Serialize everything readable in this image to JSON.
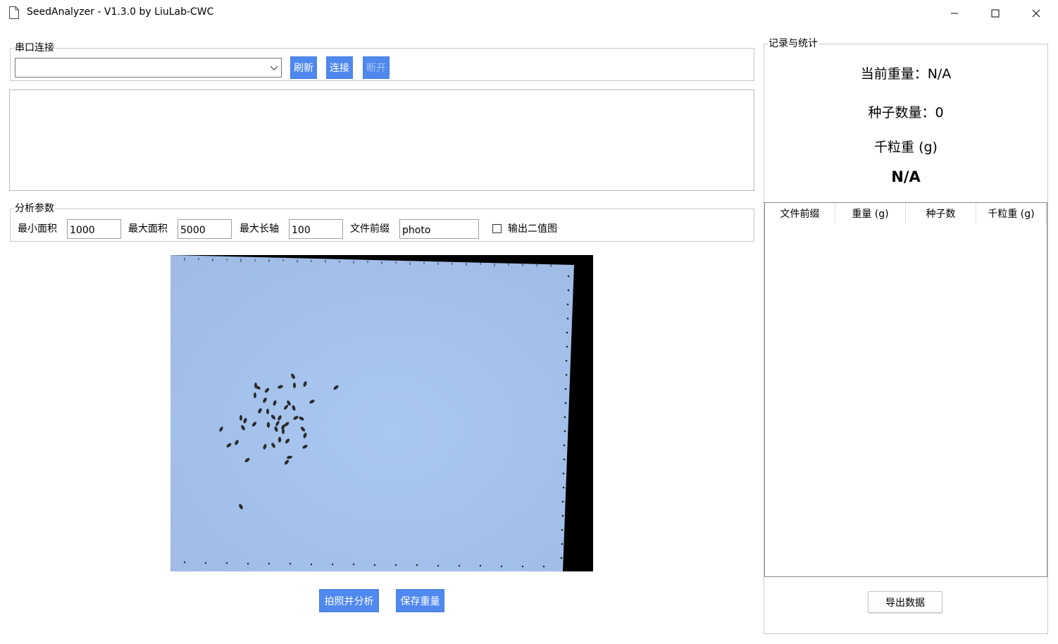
{
  "window": {
    "title": "SeedAnalyzer - V1.3.0 by LiuLab-CWC",
    "icon": "document-icon",
    "controls": [
      "minimize-icon",
      "maximize-icon",
      "close-icon"
    ]
  },
  "serial": {
    "group_label": "串口连接",
    "port_value": "",
    "refresh_label": "刷新",
    "connect_label": "连接",
    "disconnect_label": "断开",
    "log_text": ""
  },
  "params": {
    "group_label": "分析参数",
    "min_area_label": "最小面积",
    "min_area_value": "1000",
    "max_area_label": "最大面积",
    "max_area_value": "5000",
    "max_axis_label": "最大长轴",
    "max_axis_value": "100",
    "prefix_label": "文件前缀",
    "prefix_value": "photo",
    "binary_label": "输出二值图",
    "binary_checked": false
  },
  "actions": {
    "capture_label": "拍照并分析",
    "save_label": "保存重量"
  },
  "records": {
    "group_label": "记录与统计",
    "current_weight": "当前重量：N/A",
    "seed_count": "种子数量：0",
    "tkw_label": "千粒重 (g)",
    "tkw_value": "N/A",
    "columns": [
      "文件前缀",
      "重量 (g)",
      "种子数",
      "千粒重 (g)"
    ],
    "rows": [],
    "export_label": "导出数据"
  },
  "colors": {
    "accent": "#4f88ee",
    "photo_background": "#a9c7ef"
  }
}
